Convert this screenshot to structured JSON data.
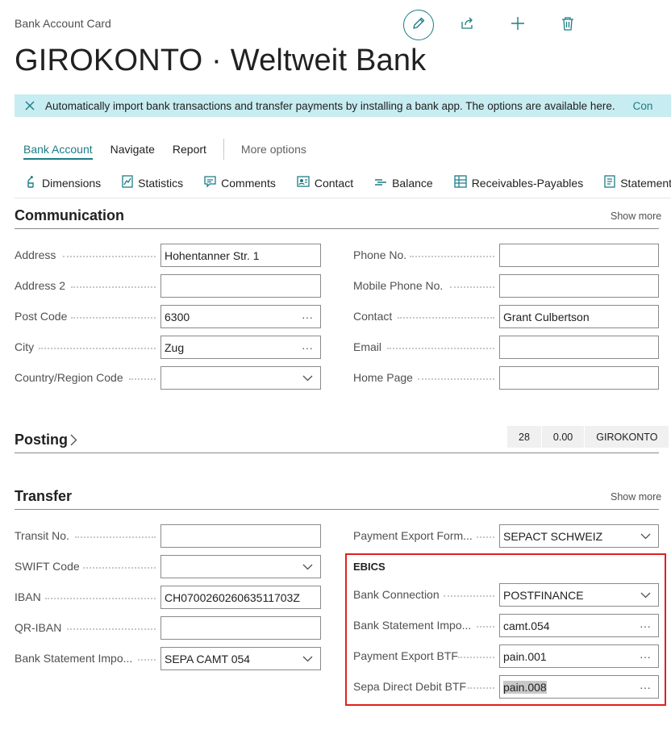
{
  "header": {
    "breadcrumb": "Bank Account Card",
    "title": "GIROKONTO · Weltweit Bank",
    "actions": [
      "pencil-icon",
      "share-icon",
      "plus-icon",
      "trash-icon"
    ]
  },
  "banner": {
    "message": "Automatically import bank transactions and transfer payments by installing a bank app. The options are available here.",
    "link": "Con"
  },
  "tabs": [
    "Bank Account",
    "Navigate",
    "Report",
    "More options"
  ],
  "toolbar": [
    "Dimensions",
    "Statistics",
    "Comments",
    "Contact",
    "Balance",
    "Receivables-Payables",
    "Statements"
  ],
  "communication": {
    "title": "Communication",
    "show_more": "Show more",
    "left": [
      {
        "label": "Address",
        "value": "Hohentanner Str. 1"
      },
      {
        "label": "Address 2",
        "value": ""
      },
      {
        "label": "Post Code",
        "value": "6300"
      },
      {
        "label": "City",
        "value": "Zug"
      },
      {
        "label": "Country/Region Code",
        "value": ""
      }
    ],
    "right": [
      {
        "label": "Phone No.",
        "value": ""
      },
      {
        "label": "Mobile Phone No.",
        "value": ""
      },
      {
        "label": "Contact",
        "value": "Grant Culbertson"
      },
      {
        "label": "Email",
        "value": ""
      },
      {
        "label": "Home Page",
        "value": ""
      }
    ]
  },
  "posting": {
    "title": "Posting",
    "chips": [
      "28",
      "0.00",
      "GIROKONTO"
    ]
  },
  "transfer": {
    "title": "Transfer",
    "show_more": "Show more",
    "left": [
      {
        "label": "Transit No.",
        "value": ""
      },
      {
        "label": "SWIFT Code",
        "value": ""
      },
      {
        "label": "IBAN",
        "value": "CH070026026063511703Z"
      },
      {
        "label": "QR-IBAN",
        "value": ""
      },
      {
        "label": "Bank Statement Impo...",
        "value": "SEPA CAMT 054"
      }
    ],
    "payment_export": {
      "label": "Payment Export Form...",
      "value": "SEPACT SCHWEIZ"
    },
    "ebics": {
      "title": "EBICS",
      "fields": [
        {
          "label": "Bank Connection",
          "value": "POSTFINANCE"
        },
        {
          "label": "Bank Statement Impo...",
          "value": "camt.054"
        },
        {
          "label": "Payment Export BTF",
          "value": "pain.001"
        },
        {
          "label": "Sepa Direct Debit BTF",
          "value": "pain.008"
        }
      ]
    }
  }
}
